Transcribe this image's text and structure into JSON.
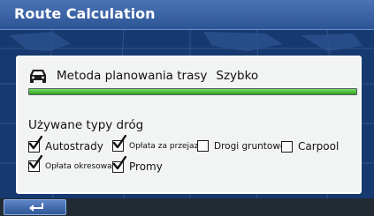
{
  "title_bar": {
    "title": "Route Calculation"
  },
  "method": {
    "icon": "car-icon",
    "label": "Metoda planowania trasy",
    "value": "Szybko",
    "progress_percent": 100
  },
  "road_types": {
    "heading": "Używane typy dróg",
    "options": [
      {
        "label": "Autostrady",
        "checked": true
      },
      {
        "label": "Opłata za przejazd",
        "checked": true
      },
      {
        "label": "Drogi gruntowe",
        "checked": false
      },
      {
        "label": "Carpool",
        "checked": false
      },
      {
        "label": "Opłata okresowa",
        "checked": true
      },
      {
        "label": "Promy",
        "checked": true
      }
    ]
  },
  "bottom_bar": {
    "back_icon": "back-arrow-icon"
  },
  "colors": {
    "title_bar": "#3b64a8",
    "panel": "#f2f4f3",
    "progress": "#4cc43b",
    "background": "#16396f"
  }
}
